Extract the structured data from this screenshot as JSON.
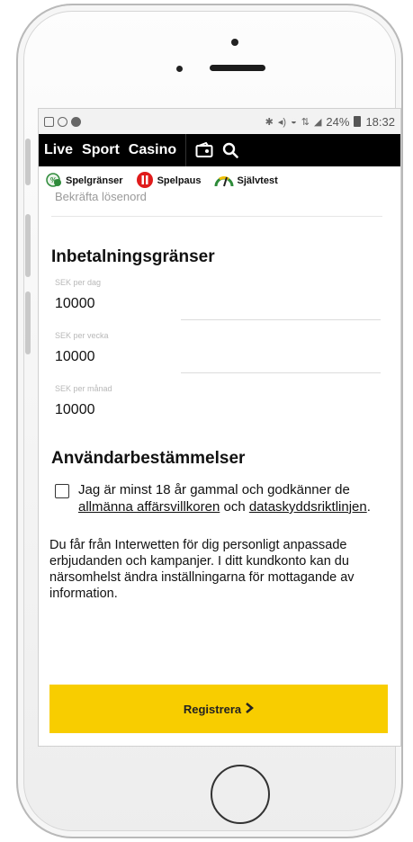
{
  "statusbar": {
    "signal_text": "24%",
    "time": "18:32"
  },
  "navbar": {
    "items": [
      {
        "label": "Live"
      },
      {
        "label": "Sport"
      },
      {
        "label": "Casino"
      }
    ],
    "icons": [
      "wallet-icon",
      "search-icon"
    ]
  },
  "responsible": {
    "items": [
      {
        "label": "Spelgränser",
        "icon": "limit-icon",
        "color": "#2e8b3a"
      },
      {
        "label": "Spelpaus",
        "icon": "pause-icon",
        "color": "#e01b1b"
      },
      {
        "label": "Självtest",
        "icon": "gauge-icon",
        "color": "#f0c000"
      }
    ]
  },
  "form": {
    "confirm_password_label": "Bekräfta lösenord",
    "deposit_title": "Inbetalningsgränser",
    "fields": [
      {
        "label": "SEK per dag",
        "value": "10000"
      },
      {
        "label": "SEK per vecka",
        "value": "10000"
      },
      {
        "label": "SEK per månad",
        "value": "10000"
      }
    ],
    "terms_title": "Användarbestämmelser",
    "terms_text_prefix": "Jag är minst 18 år gammal och godkänner de",
    "terms_link1": "allmänna affärsvillkoren",
    "terms_middle": " och",
    "terms_link2": "dataskyddsriktlinjen",
    "terms_suffix": ".",
    "info_text": "Du får från Interwetten för dig personligt anpassade erbjudanden och kampanjer. I ditt kundkonto kan du närsomhelst ändra inställningarna för mottagande av information.",
    "register_label": "Registrera",
    "register_color": "#f8cd00"
  }
}
